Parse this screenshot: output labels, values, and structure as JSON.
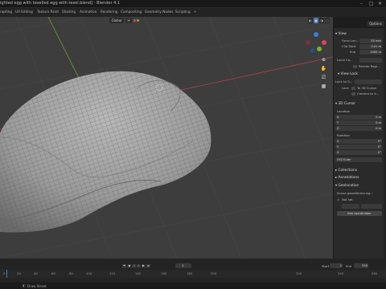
{
  "app": {
    "title": "ighted egg with texelled egg with texel.blend] - Blender 4.1",
    "win_min": "–",
    "win_max": "□",
    "win_close": "✕"
  },
  "workspaces": [
    "rapting",
    "UV Editing",
    "Texture Paint",
    "Shading",
    "Animation",
    "Rendering",
    "Compositing",
    "Geometry Nodes",
    "Scripting",
    "+"
  ],
  "viewport": {
    "mode": "Global",
    "options_label": "Options"
  },
  "npanel": {
    "view": {
      "header": "View",
      "focal_label": "Focal Len...",
      "focal_value": "50 mm",
      "clip_start_label": "Clip Start",
      "clip_start_value": "0.01 m",
      "clip_end_label": "End",
      "clip_end_value": "1000 m",
      "local_camera_label": "Local Ca...",
      "render_region_label": "Render Regi..."
    },
    "view_lock": {
      "header": "View Lock",
      "lock_to_object_label": "Lock to O...",
      "lock_label": "Lock",
      "to_3d_cursor": "To 3D Cursor",
      "camera_to_view": "Camera to V..."
    },
    "cursor": {
      "header": "3D Cursor",
      "location_label": "Location",
      "x_label": "X",
      "x_value": "0 m",
      "y_label": "Y",
      "y_value": "0 m",
      "z_label": "Z",
      "z_value": "0 m",
      "rotation_label": "Rotation",
      "rx_label": "X",
      "rx_value": "0°",
      "ry_label": "Y",
      "ry_value": "0°",
      "rz_label": "Z",
      "rz_value": "0°",
      "rotation_mode": "XYZ Euler"
    },
    "collections": "Collections",
    "annotations": "Annotations",
    "geolocation": {
      "header": "Geolocation",
      "scene_label": "Scene georeferencing :",
      "not_set": "Not set",
      "geo_coordinates_button": "Geo coordinates"
    }
  },
  "timeline": {
    "ticks": [
      "0",
      "20",
      "40",
      "60",
      "80",
      "100",
      "120",
      "140",
      "160",
      "180",
      "200",
      "220",
      "240",
      "260"
    ],
    "start_label": "Start",
    "start_value": "1",
    "end_label": "End",
    "end_value": "250",
    "current_frame": "1"
  },
  "statusbar": {
    "text": "Draw Street"
  },
  "colors": {
    "accent": "#4a77b8",
    "axis_x": "#e0425a",
    "axis_y": "#7ab32b",
    "axis_z": "#3a7fd6"
  }
}
